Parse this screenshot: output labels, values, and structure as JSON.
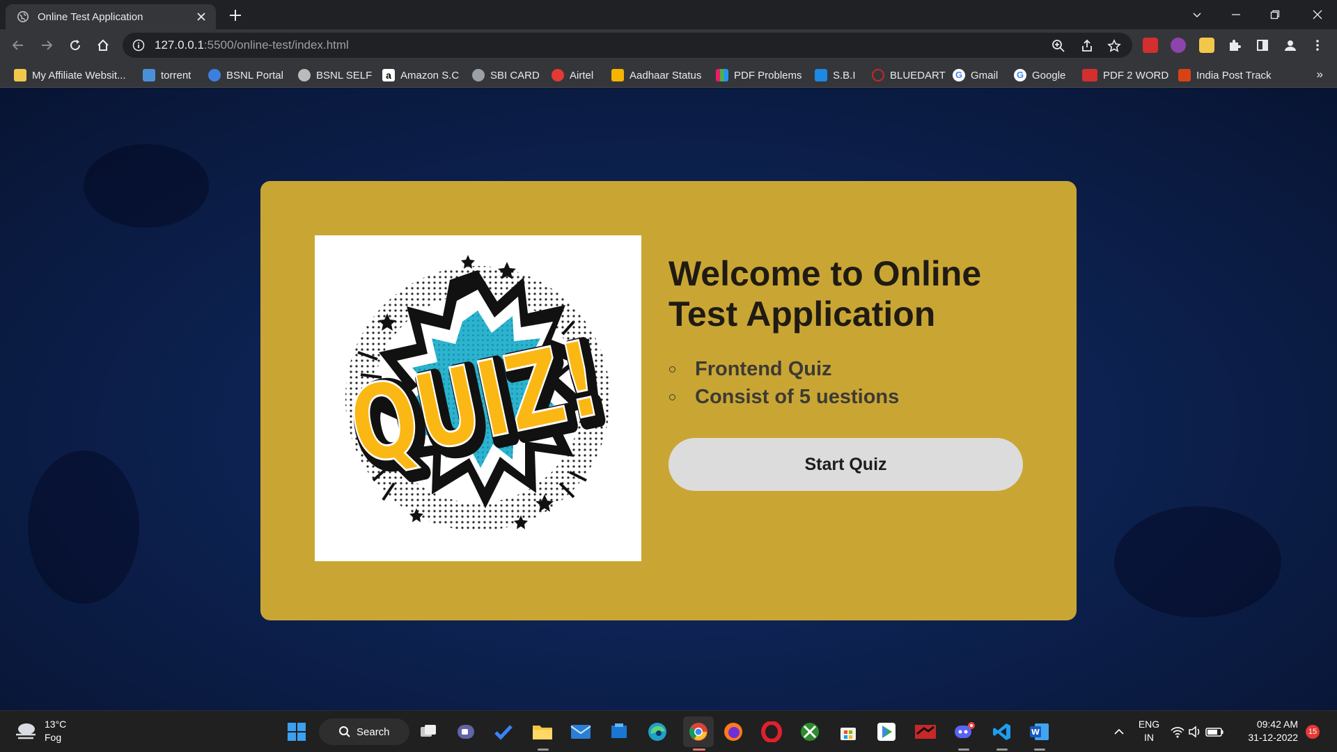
{
  "browser": {
    "tab": {
      "title": "Online Test Application"
    },
    "address": {
      "host": "127.0.0.1",
      "path": ":5500/online-test/index.html"
    },
    "bookmarks": [
      {
        "label": "My Affiliate Websit...",
        "icon": "bookmark-folder-icon",
        "color": "#f2c84b"
      },
      {
        "label": "torrent",
        "icon": "torrent-icon",
        "color": "#4a90d9"
      },
      {
        "label": "BSNL Portal",
        "icon": "bsnl-icon",
        "color": "#3d7fe0"
      },
      {
        "label": "BSNL SELF",
        "icon": "bsnl-self-icon",
        "color": "#bbbbbb"
      },
      {
        "label": "Amazon S.C",
        "icon": "amazon-icon",
        "color": "#ffffff"
      },
      {
        "label": "SBI CARD",
        "icon": "globe-icon",
        "color": "#9aa0a6"
      },
      {
        "label": "Airtel",
        "icon": "airtel-icon",
        "color": "#e53935"
      },
      {
        "label": "Aadhaar Status",
        "icon": "aadhaar-icon",
        "color": "#f4b400"
      },
      {
        "label": "PDF Problems",
        "icon": "pdf-problems-icon",
        "color": "#e91e63"
      },
      {
        "label": "S.B.I",
        "icon": "sbi-icon",
        "color": "#1e88e5"
      },
      {
        "label": "BLUEDART",
        "icon": "bluedart-icon",
        "color": "#c62828"
      },
      {
        "label": "Gmail",
        "icon": "google-g-icon",
        "color": "#4285f4"
      },
      {
        "label": "Google",
        "icon": "google-g-icon",
        "color": "#4285f4"
      },
      {
        "label": "PDF 2 WORD",
        "icon": "pdf-icon",
        "color": "#d32f2f"
      },
      {
        "label": "India Post Track",
        "icon": "india-post-icon",
        "color": "#d84315"
      }
    ],
    "more": "»"
  },
  "page": {
    "headline": "Welcome to Online Test Application",
    "features": [
      "Frontend Quiz",
      "Consist of 5 uestions"
    ],
    "start_button": "Start Quiz",
    "quiz_logo_text": "QUIZ!"
  },
  "taskbar": {
    "weather": {
      "temp": "13°C",
      "condition": "Fog"
    },
    "search_label": "Search",
    "lang": {
      "line1": "ENG",
      "line2": "IN"
    },
    "time": "09:42 AM",
    "date": "31-12-2022",
    "notifications": "15"
  },
  "colors": {
    "card": "#c9a634",
    "button": "#dcdcdc",
    "page_bg": "#0d2251"
  }
}
